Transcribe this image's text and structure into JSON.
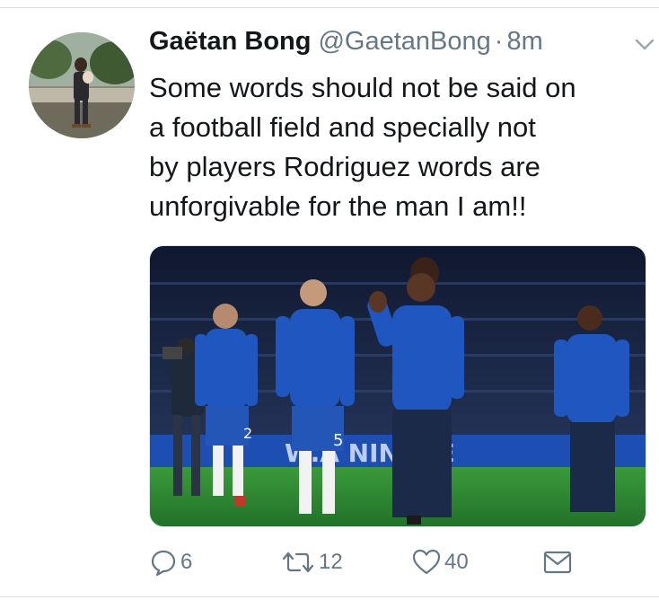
{
  "tweet": {
    "author": {
      "display_name": "Gaëtan Bong",
      "handle": "@GaetanBong",
      "separator": "·",
      "time": "8m"
    },
    "text_lines": [
      "Some words should not be said on",
      "a football field and specially not",
      "by players Rodriguez words are",
      "unforgivable for the man I am!!"
    ],
    "media": {
      "banner_text": "W.A    NINTHE",
      "shirt_numbers": [
        "2",
        "5"
      ]
    },
    "actions": {
      "reply_count": "6",
      "retweet_count": "12",
      "like_count": "40"
    }
  },
  "icons": {
    "reply": "reply-icon",
    "retweet": "retweet-icon",
    "like": "heart-icon",
    "share": "envelope-icon",
    "menu": "chevron-down-icon"
  },
  "colors": {
    "text_primary": "#14171a",
    "text_secondary": "#657786",
    "kit_blue": "#1f56c0",
    "pitch_green": "#2d8a2e"
  }
}
